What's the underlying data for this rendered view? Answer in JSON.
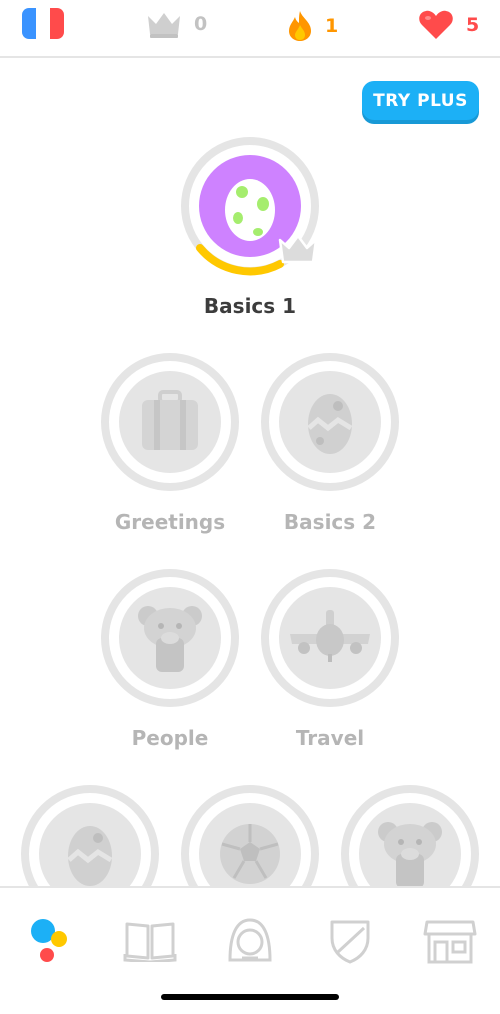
{
  "topbar": {
    "language": "French",
    "crowns": "0",
    "streak": "1",
    "hearts": "5",
    "colors": {
      "crown": "#cecece",
      "streak": "#ff9600",
      "hearts": "#ff4b4b"
    }
  },
  "promo": {
    "label": "TRY PLUS"
  },
  "skills": [
    {
      "label": "Basics 1",
      "icon": "egg-icon",
      "state": "active"
    },
    {
      "label": "Greetings",
      "icon": "suitcase-icon",
      "state": "locked"
    },
    {
      "label": "Basics 2",
      "icon": "egg-icon",
      "state": "locked"
    },
    {
      "label": "People",
      "icon": "bear-icon",
      "state": "locked"
    },
    {
      "label": "Travel",
      "icon": "airplane-icon",
      "state": "locked"
    },
    {
      "label": "",
      "icon": "egg-icon",
      "state": "locked"
    },
    {
      "label": "",
      "icon": "soccer-ball-icon",
      "state": "locked"
    },
    {
      "label": "",
      "icon": "bear-icon",
      "state": "locked"
    }
  ],
  "nav": [
    {
      "name": "learn",
      "icon": "learn-dots-icon",
      "active": true
    },
    {
      "name": "stories",
      "icon": "book-icon",
      "active": false
    },
    {
      "name": "profile",
      "icon": "profile-face-icon",
      "active": false
    },
    {
      "name": "leaderboards",
      "icon": "shield-icon",
      "active": false
    },
    {
      "name": "shop",
      "icon": "shop-icon",
      "active": false
    }
  ]
}
